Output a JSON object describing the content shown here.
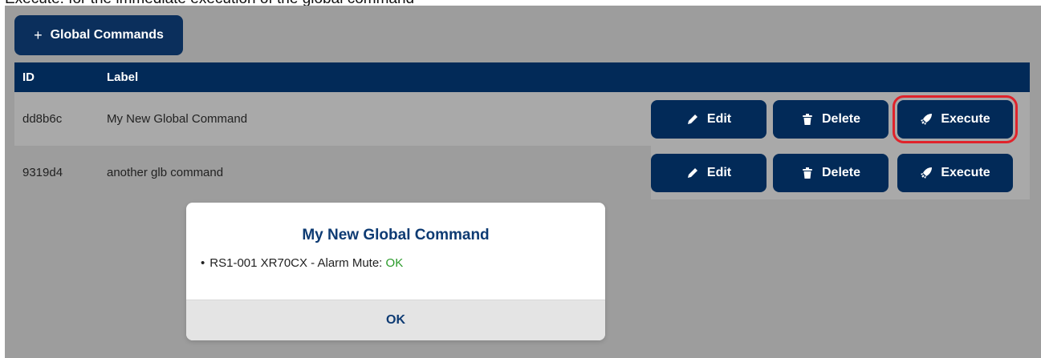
{
  "caption": "Execute: for the immediate execution of the global command",
  "toolbar": {
    "add_label": "Global Commands",
    "add_icon": "plus-icon"
  },
  "table": {
    "headers": [
      "ID",
      "Label"
    ],
    "rows": [
      {
        "id": "dd8b6c",
        "label": "My New Global Command"
      },
      {
        "id": "9319d4",
        "label": "another glb command"
      }
    ],
    "actions": {
      "edit_label": "Edit",
      "edit_icon": "pencil-icon",
      "delete_label": "Delete",
      "delete_icon": "trash-icon",
      "execute_label": "Execute",
      "execute_icon": "rocket-icon"
    }
  },
  "modal": {
    "title": "My New Global Command",
    "items": [
      {
        "text": "RS1-001 XR70CX - Alarm Mute:",
        "status": "OK"
      }
    ],
    "ok_label": "OK"
  },
  "colors": {
    "primary": "#022a58",
    "overlay": "#9d9d9d",
    "highlight": "#e0232b",
    "status_ok": "#2a9a2a"
  }
}
